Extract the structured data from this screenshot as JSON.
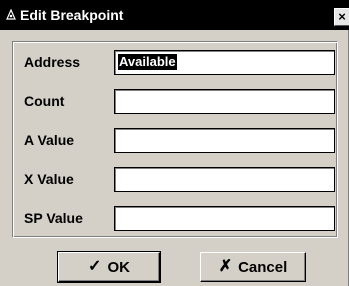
{
  "window": {
    "title": "Edit Breakpoint",
    "close_glyph": "×"
  },
  "form": {
    "fields": [
      {
        "label": "Address",
        "value": "Available"
      },
      {
        "label": "Count",
        "value": ""
      },
      {
        "label": "A Value",
        "value": ""
      },
      {
        "label": "X Value",
        "value": ""
      },
      {
        "label": "SP Value",
        "value": ""
      }
    ]
  },
  "buttons": {
    "ok_label": "OK",
    "ok_icon": "✓",
    "cancel_label": "Cancel",
    "cancel_icon": "✗"
  },
  "icons": {
    "title_icon": "debug-bug-icon",
    "ok_icon_name": "checkmark-icon",
    "cancel_icon_name": "x-mark-icon"
  }
}
